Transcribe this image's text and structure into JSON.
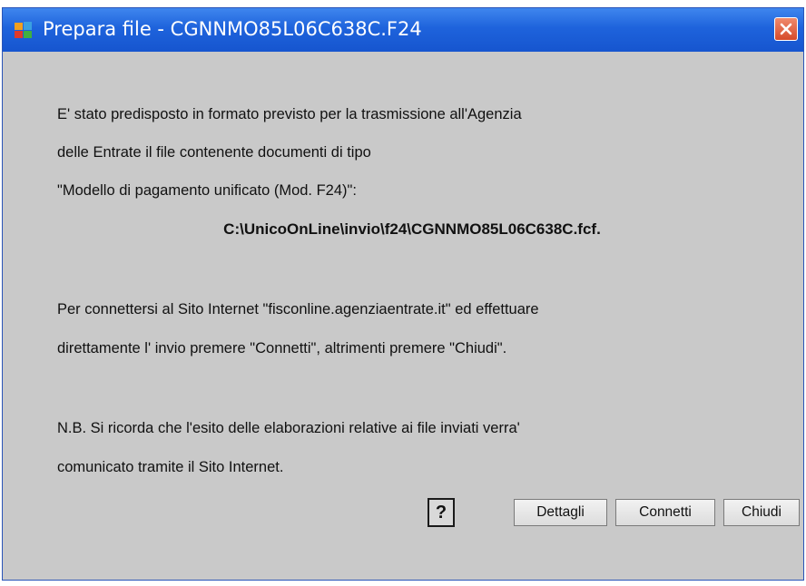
{
  "window": {
    "title": "Prepara file - CGNNMO85L06C638C.F24"
  },
  "message": {
    "line1": "E' stato predisposto in formato previsto per la trasmissione all'Agenzia",
    "line2": "delle Entrate il file contenente documenti di tipo",
    "line3": "\"Modello di pagamento unificato (Mod. F24)\":",
    "file_path": "C:\\UnicoOnLine\\invio\\f24\\CGNNMO85L06C638C.fcf.",
    "line4": "Per connettersi al Sito Internet \"fisconline.agenziaentrate.it\" ed effettuare",
    "line5": "direttamente l' invio premere  \"Connetti\", altrimenti premere  \"Chiudi\".",
    "line6": "N.B.  Si ricorda che l'esito delle elaborazioni relative ai file inviati verra'",
    "line7": "comunicato tramite  il  Sito Internet."
  },
  "buttons": {
    "help": "?",
    "details": "Dettagli",
    "connect": "Connetti",
    "close": "Chiudi"
  },
  "icons": {
    "app": "app-logo-icon",
    "close": "close-icon"
  },
  "colors": {
    "titlebar": "#1e63dc",
    "window_bg": "#c9c9c9",
    "close_button": "#d54a2a"
  }
}
